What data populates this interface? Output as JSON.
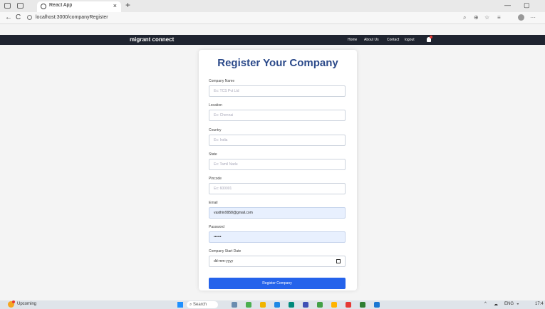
{
  "browser": {
    "tab_title": "React App",
    "tab_close": "×",
    "new_tab": "+",
    "url": "localhost:3000/companyRegister",
    "back": "←",
    "reload": "C",
    "min": "—",
    "restore": "▢"
  },
  "navbar": {
    "brand": "migrant connect",
    "links": [
      "Home",
      "About Us",
      "Contact",
      "logout"
    ]
  },
  "form": {
    "title": "Register Your Company",
    "fields": [
      {
        "label": "Company Name",
        "placeholder": "Ex: TCS Pvt Ltd",
        "value": ""
      },
      {
        "label": "Location",
        "placeholder": "Ex: Chennai",
        "value": ""
      },
      {
        "label": "Country",
        "placeholder": "Ex: India",
        "value": ""
      },
      {
        "label": "State",
        "placeholder": "Ex: Tamil Nadu",
        "value": ""
      },
      {
        "label": "Pincode",
        "placeholder": "Ex: 600001",
        "value": ""
      },
      {
        "label": "Email",
        "placeholder": "",
        "value": "vasthin9958@gmail.com"
      },
      {
        "label": "Password",
        "placeholder": "",
        "value": "••••••"
      },
      {
        "label": "Company Start Date",
        "placeholder": "dd-mm-yyyy",
        "value": ""
      }
    ],
    "submit_label": "Register Company"
  },
  "taskbar": {
    "weather_label": "Upcoming",
    "search_label": "Search",
    "lang": "ENG",
    "time": "17:4"
  },
  "colors": {
    "navbar_bg": "#1f2430",
    "title": "#2c4a8a",
    "button": "#2563eb",
    "autofill": "#e8f0fe"
  }
}
